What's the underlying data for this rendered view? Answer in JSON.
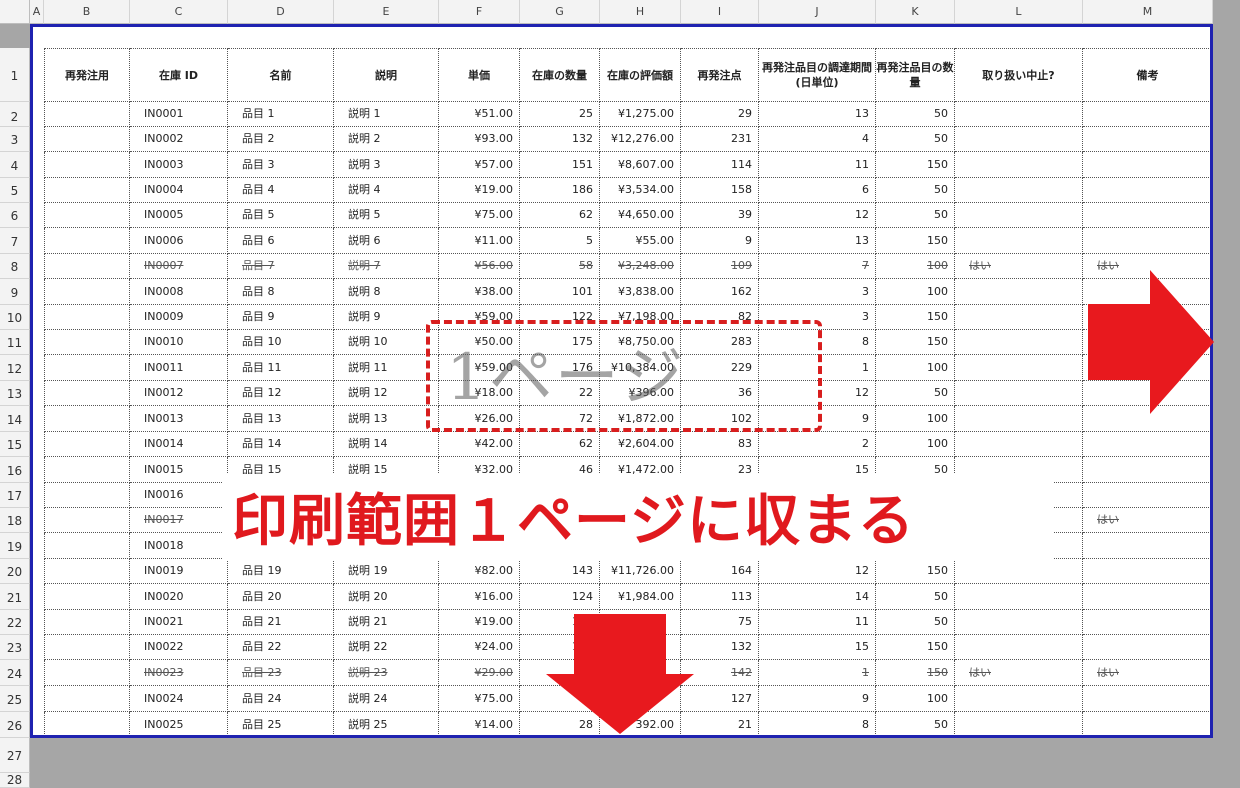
{
  "column_letters": [
    "A",
    "B",
    "C",
    "D",
    "E",
    "F",
    "G",
    "H",
    "I",
    "J",
    "K",
    "L",
    "M"
  ],
  "row_numbers": [
    "1",
    "2",
    "3",
    "4",
    "5",
    "6",
    "7",
    "8",
    "9",
    "10",
    "11",
    "12",
    "13",
    "14",
    "15",
    "16",
    "17",
    "18",
    "19",
    "20",
    "21",
    "22",
    "23",
    "24",
    "25",
    "26",
    "27",
    "28"
  ],
  "headers": [
    "再発注用",
    "在庫 ID",
    "名前",
    "説明",
    "単価",
    "在庫の数量",
    "在庫の評価額",
    "再発注点",
    "再発注品目の調達期間 (日単位)",
    "再発注品目の数量",
    "取り扱い中止?",
    "備考"
  ],
  "rows": [
    {
      "id": "IN0001",
      "name": "品目 1",
      "desc": "説明 1",
      "price": "¥51.00",
      "qty": "25",
      "value": "¥1,275.00",
      "reorder": "29",
      "days": "13",
      "rqty": "50",
      "disc": "",
      "note": "",
      "strike": false
    },
    {
      "id": "IN0002",
      "name": "品目 2",
      "desc": "説明 2",
      "price": "¥93.00",
      "qty": "132",
      "value": "¥12,276.00",
      "reorder": "231",
      "days": "4",
      "rqty": "50",
      "disc": "",
      "note": "",
      "strike": false
    },
    {
      "id": "IN0003",
      "name": "品目 3",
      "desc": "説明 3",
      "price": "¥57.00",
      "qty": "151",
      "value": "¥8,607.00",
      "reorder": "114",
      "days": "11",
      "rqty": "150",
      "disc": "",
      "note": "",
      "strike": false
    },
    {
      "id": "IN0004",
      "name": "品目 4",
      "desc": "説明 4",
      "price": "¥19.00",
      "qty": "186",
      "value": "¥3,534.00",
      "reorder": "158",
      "days": "6",
      "rqty": "50",
      "disc": "",
      "note": "",
      "strike": false
    },
    {
      "id": "IN0005",
      "name": "品目 5",
      "desc": "説明 5",
      "price": "¥75.00",
      "qty": "62",
      "value": "¥4,650.00",
      "reorder": "39",
      "days": "12",
      "rqty": "50",
      "disc": "",
      "note": "",
      "strike": false
    },
    {
      "id": "IN0006",
      "name": "品目 6",
      "desc": "説明 6",
      "price": "¥11.00",
      "qty": "5",
      "value": "¥55.00",
      "reorder": "9",
      "days": "13",
      "rqty": "150",
      "disc": "",
      "note": "",
      "strike": false
    },
    {
      "id": "IN0007",
      "name": "品目 7",
      "desc": "説明 7",
      "price": "¥56.00",
      "qty": "58",
      "value": "¥3,248.00",
      "reorder": "109",
      "days": "7",
      "rqty": "100",
      "disc": "はい",
      "note": "はい",
      "strike": true
    },
    {
      "id": "IN0008",
      "name": "品目 8",
      "desc": "説明 8",
      "price": "¥38.00",
      "qty": "101",
      "value": "¥3,838.00",
      "reorder": "162",
      "days": "3",
      "rqty": "100",
      "disc": "",
      "note": "",
      "strike": false
    },
    {
      "id": "IN0009",
      "name": "品目 9",
      "desc": "説明 9",
      "price": "¥59.00",
      "qty": "122",
      "value": "¥7,198.00",
      "reorder": "82",
      "days": "3",
      "rqty": "150",
      "disc": "",
      "note": "",
      "strike": false
    },
    {
      "id": "IN0010",
      "name": "品目 10",
      "desc": "説明 10",
      "price": "¥50.00",
      "qty": "175",
      "value": "¥8,750.00",
      "reorder": "283",
      "days": "8",
      "rqty": "150",
      "disc": "",
      "note": "",
      "strike": false
    },
    {
      "id": "IN0011",
      "name": "品目 11",
      "desc": "説明 11",
      "price": "¥59.00",
      "qty": "176",
      "value": "¥10,384.00",
      "reorder": "229",
      "days": "1",
      "rqty": "100",
      "disc": "",
      "note": "",
      "strike": false
    },
    {
      "id": "IN0012",
      "name": "品目 12",
      "desc": "説明 12",
      "price": "¥18.00",
      "qty": "22",
      "value": "¥396.00",
      "reorder": "36",
      "days": "12",
      "rqty": "50",
      "disc": "",
      "note": "",
      "strike": false
    },
    {
      "id": "IN0013",
      "name": "品目 13",
      "desc": "説明 13",
      "price": "¥26.00",
      "qty": "72",
      "value": "¥1,872.00",
      "reorder": "102",
      "days": "9",
      "rqty": "100",
      "disc": "",
      "note": "",
      "strike": false
    },
    {
      "id": "IN0014",
      "name": "品目 14",
      "desc": "説明 14",
      "price": "¥42.00",
      "qty": "62",
      "value": "¥2,604.00",
      "reorder": "83",
      "days": "2",
      "rqty": "100",
      "disc": "",
      "note": "",
      "strike": false
    },
    {
      "id": "IN0015",
      "name": "品目 15",
      "desc": "説明 15",
      "price": "¥32.00",
      "qty": "46",
      "value": "¥1,472.00",
      "reorder": "23",
      "days": "15",
      "rqty": "50",
      "disc": "",
      "note": "",
      "strike": false
    },
    {
      "id": "IN0016",
      "name": "",
      "desc": "",
      "price": "",
      "qty": "",
      "value": "",
      "reorder": "",
      "days": "",
      "rqty": "",
      "disc": "",
      "note": "",
      "strike": false
    },
    {
      "id": "IN0017",
      "name": "",
      "desc": "",
      "price": "",
      "qty": "",
      "value": "",
      "reorder": "",
      "days": "",
      "rqty": "",
      "disc": "",
      "note": "はい",
      "strike": true
    },
    {
      "id": "IN0018",
      "name": "",
      "desc": "",
      "price": "",
      "qty": "",
      "value": "",
      "reorder": "",
      "days": "",
      "rqty": "",
      "disc": "",
      "note": "",
      "strike": false
    },
    {
      "id": "IN0019",
      "name": "品目 19",
      "desc": "説明 19",
      "price": "¥82.00",
      "qty": "143",
      "value": "¥11,726.00",
      "reorder": "164",
      "days": "12",
      "rqty": "150",
      "disc": "",
      "note": "",
      "strike": false
    },
    {
      "id": "IN0020",
      "name": "品目 20",
      "desc": "説明 20",
      "price": "¥16.00",
      "qty": "124",
      "value": "¥1,984.00",
      "reorder": "113",
      "days": "14",
      "rqty": "50",
      "disc": "",
      "note": "",
      "strike": false
    },
    {
      "id": "IN0021",
      "name": "品目 21",
      "desc": "説明 21",
      "price": "¥19.00",
      "qty": "112",
      "value": "",
      "reorder": "75",
      "days": "11",
      "rqty": "50",
      "disc": "",
      "note": "",
      "strike": false
    },
    {
      "id": "IN0022",
      "name": "品目 22",
      "desc": "説明 22",
      "price": "¥24.00",
      "qty": "182",
      "value": "",
      "reorder": "132",
      "days": "15",
      "rqty": "150",
      "disc": "",
      "note": "",
      "strike": false
    },
    {
      "id": "IN0023",
      "name": "品目 23",
      "desc": "説明 23",
      "price": "¥29.00",
      "qty": "",
      "value": "",
      "reorder": "142",
      "days": "1",
      "rqty": "150",
      "disc": "はい",
      "note": "はい",
      "strike": true
    },
    {
      "id": "IN0024",
      "name": "品目 24",
      "desc": "説明 24",
      "price": "¥75.00",
      "qty": "1",
      "value": "",
      "reorder": "127",
      "days": "9",
      "rqty": "100",
      "disc": "",
      "note": "",
      "strike": false
    },
    {
      "id": "IN0025",
      "name": "品目 25",
      "desc": "説明 25",
      "price": "¥14.00",
      "qty": "28",
      "value": "392.00",
      "reorder": "21",
      "days": "8",
      "rqty": "50",
      "disc": "",
      "note": "",
      "strike": false
    }
  ],
  "annotation": {
    "page_label": "1ページ",
    "banner": "印刷範囲１ページに収まる",
    "arrow_color": "#e8191e",
    "page_border_color": "#1f22b0"
  }
}
